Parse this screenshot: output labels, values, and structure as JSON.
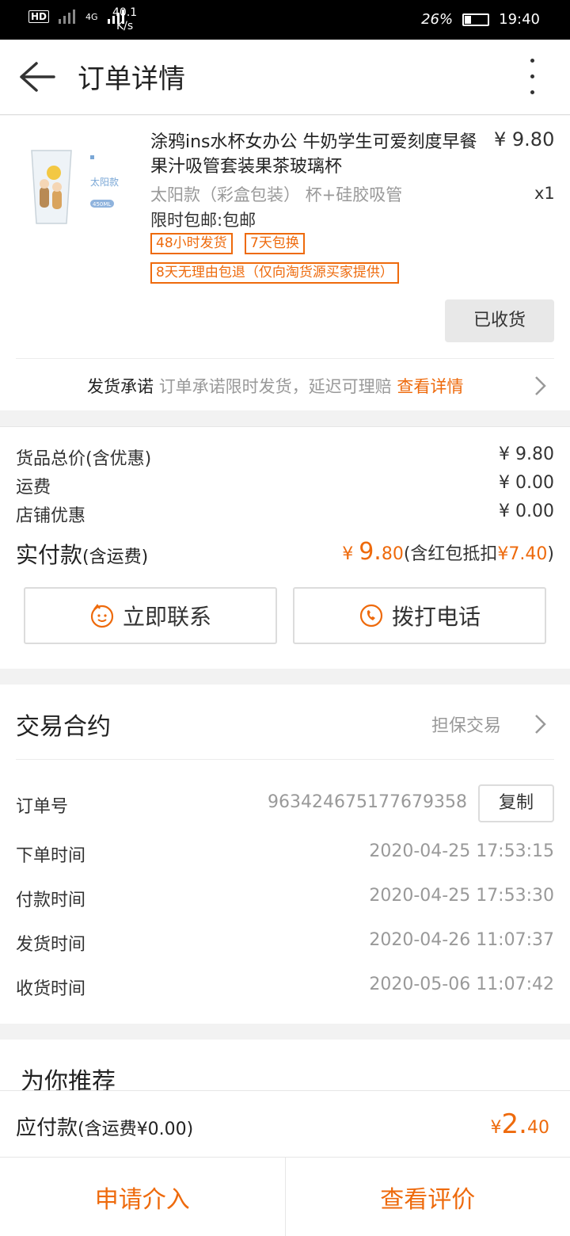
{
  "status_bar": {
    "signal_labels": [
      "HD",
      "4G"
    ],
    "speed_value": "40.1",
    "speed_unit": "K/s",
    "battery": "26%",
    "time": "19:40"
  },
  "header": {
    "title": "订单详情"
  },
  "product": {
    "name": "涂鸦ins水杯女办公 牛奶学生可爱刻度早餐果汁吸管套装果茶玻璃杯",
    "price": "¥ 9.80",
    "sku": "太阳款（彩盒包装） 杯+硅胶吸管",
    "qty": "x1",
    "shipping": "限时包邮:包邮",
    "image_label": "太阳款",
    "image_capacity": "450ML",
    "tags": [
      "48小时发货",
      "7天包换",
      "8天无理由包退（仅向淘货源买家提供）"
    ],
    "received_label": "已收货"
  },
  "promise": {
    "label": "发货承诺",
    "text": "订单承诺限时发货，延迟可理赔",
    "link": "查看详情"
  },
  "price_summary": {
    "rows": [
      {
        "label": "货品总价(含优惠)",
        "value": "¥ 9.80"
      },
      {
        "label": "运费",
        "value": "¥ 0.00"
      },
      {
        "label": "店铺优惠",
        "value": "¥ 0.00"
      }
    ],
    "paid_label": "实付款",
    "paid_note": "(含运费)",
    "paid_symbol": "¥ ",
    "paid_int": "9.",
    "paid_dec": "80",
    "paid_extra_prefix": "(含红包抵扣",
    "paid_extra_amount": "¥7.40",
    "paid_extra_suffix": ")"
  },
  "contact": {
    "chat_label": "立即联系",
    "call_label": "拨打电话"
  },
  "trade": {
    "title": "交易合约",
    "type": "担保交易",
    "order_no_label": "订单号",
    "order_no": "963424675177679358",
    "copy_label": "复制",
    "rows": [
      {
        "label": "下单时间",
        "value": "2020-04-25 17:53:15"
      },
      {
        "label": "付款时间",
        "value": "2020-04-25 17:53:30"
      },
      {
        "label": "发货时间",
        "value": "2020-04-26 11:07:37"
      },
      {
        "label": "收货时间",
        "value": "2020-05-06 11:07:42"
      }
    ]
  },
  "recommend": {
    "title": "为你推荐"
  },
  "payable": {
    "label": "应付款",
    "note": "(含运费¥0.00)",
    "symbol": "¥",
    "int": "2.",
    "dec": "40"
  },
  "actions": {
    "intervene": "申请介入",
    "review": "查看评价"
  },
  "colors": {
    "accent": "#ee6a0c"
  }
}
